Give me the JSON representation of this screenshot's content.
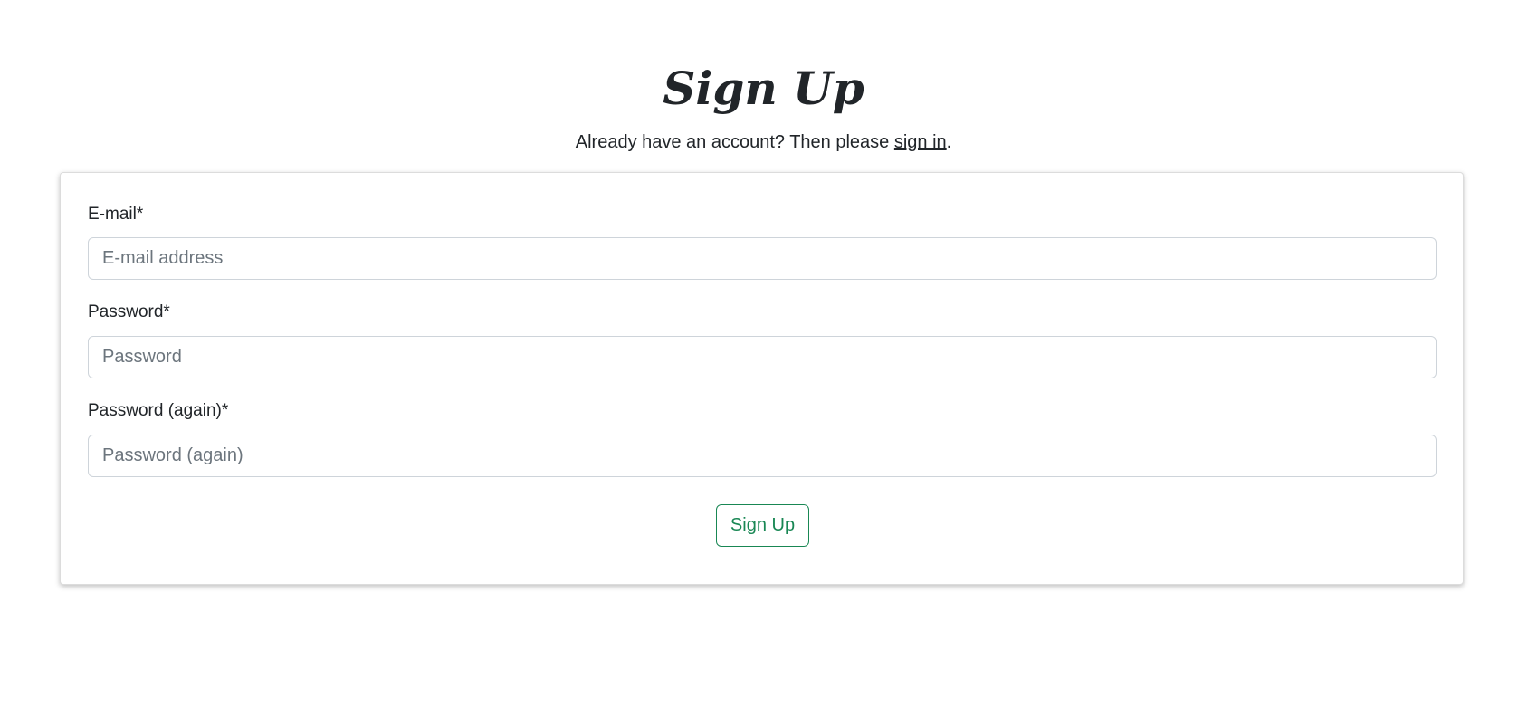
{
  "header": {
    "title": "Sign Up",
    "subtitle_prefix": "Already have an account? Then please ",
    "signin_link": "sign in",
    "subtitle_suffix": "."
  },
  "form": {
    "email": {
      "label": "E-mail*",
      "placeholder": "E-mail address",
      "value": ""
    },
    "password": {
      "label": "Password*",
      "placeholder": "Password",
      "value": ""
    },
    "password2": {
      "label": "Password (again)*",
      "placeholder": "Password (again)",
      "value": ""
    },
    "submit_label": "Sign Up"
  },
  "colors": {
    "accent": "#198754",
    "text": "#212529",
    "placeholder": "#6c757d"
  }
}
